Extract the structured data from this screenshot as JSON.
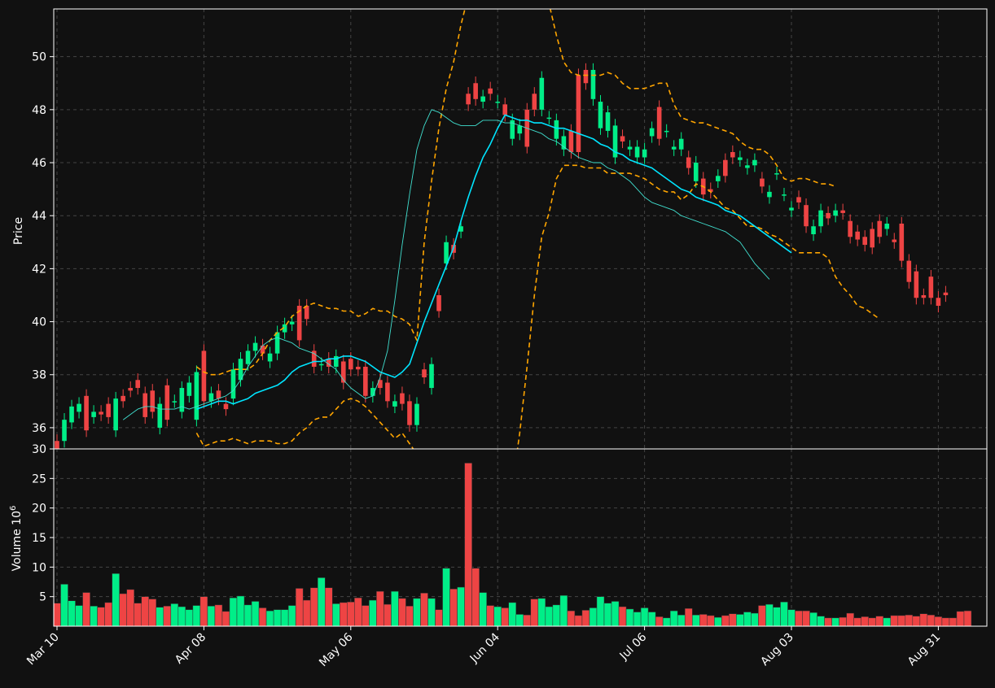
{
  "colors": {
    "background": "#111111",
    "up": "#00ee88",
    "down": "#ee4444",
    "bollinger": "#ffa500",
    "ma_slow": "#00e5ff",
    "ma_fast": "#40e0d0",
    "grid": "#444444",
    "axes": "#ffffff"
  },
  "chart_data": [
    {
      "type": "candlestick",
      "ylabel": "Price",
      "ylim": [
        35.2,
        51.8
      ],
      "yticks": [
        36,
        38,
        40,
        42,
        44,
        46,
        48,
        50
      ],
      "grid": true,
      "x_tick_labels": [
        "Mar 10",
        "Apr 08",
        "May 06",
        "Jun 04",
        "Jul 06",
        "Aug 03",
        "Aug 31"
      ],
      "x_tick_index": [
        0,
        20,
        40,
        60,
        80,
        100,
        120
      ],
      "open": [
        35.5,
        35.5,
        36.2,
        36.6,
        37.2,
        36.4,
        36.6,
        36.9,
        35.9,
        37.2,
        37.5,
        37.8,
        37.3,
        37.4,
        36.0,
        37.6,
        37.0,
        36.6,
        37.2,
        36.3,
        38.9,
        37.0,
        37.4,
        36.9,
        37.1,
        37.8,
        38.4,
        38.9,
        39.1,
        38.5,
        38.8,
        39.6,
        39.9,
        40.6,
        40.6,
        38.9,
        38.4,
        38.6,
        38.3,
        38.5,
        38.6,
        38.3,
        38.3,
        37.2,
        37.8,
        37.7,
        36.8,
        37.3,
        37.0,
        36.1,
        38.2,
        37.5,
        41.0,
        42.2,
        42.9,
        43.4,
        48.6,
        49.0,
        48.3,
        48.8,
        48.3,
        48.2,
        46.9,
        47.1,
        48.0,
        48.6,
        48.0,
        47.7,
        46.9,
        46.5,
        47.2,
        49.3,
        49.5,
        48.4,
        47.3,
        47.2,
        46.2,
        47.0,
        46.5,
        46.2,
        46.2,
        47.0,
        48.1,
        47.2,
        46.5,
        46.5,
        46.2,
        45.3,
        45.4,
        45.0,
        45.3,
        46.1,
        46.4,
        46.1,
        45.8,
        45.9,
        45.4,
        44.7,
        45.6,
        44.8,
        44.2,
        44.7,
        44.4,
        43.3,
        43.6,
        44.1,
        44.0,
        44.2,
        43.8,
        43.4,
        43.2,
        43.5,
        43.8,
        43.5,
        43.1,
        43.7,
        42.3,
        41.9,
        41.0,
        41.7,
        40.9,
        41.1
      ],
      "close": [
        35.2,
        36.3,
        36.8,
        36.9,
        35.9,
        36.6,
        36.5,
        36.4,
        37.1,
        37.0,
        37.4,
        37.5,
        36.4,
        36.6,
        36.9,
        36.3,
        37.0,
        37.5,
        37.7,
        38.1,
        37.0,
        37.3,
        37.1,
        36.7,
        38.2,
        38.6,
        38.9,
        39.2,
        38.8,
        38.8,
        39.6,
        39.9,
        40.0,
        39.3,
        40.1,
        38.3,
        38.4,
        38.3,
        38.7,
        37.7,
        38.2,
        38.2,
        37.2,
        37.5,
        37.5,
        37.0,
        37.0,
        36.9,
        36.1,
        36.9,
        37.9,
        38.4,
        40.4,
        43.0,
        42.6,
        43.6,
        48.2,
        48.4,
        48.5,
        48.6,
        48.3,
        47.8,
        47.6,
        47.4,
        46.6,
        48.0,
        49.2,
        47.7,
        47.6,
        47.0,
        46.4,
        46.4,
        49.0,
        49.5,
        48.3,
        47.9,
        47.4,
        46.8,
        46.6,
        46.6,
        46.5,
        47.3,
        46.9,
        47.2,
        46.6,
        46.9,
        45.8,
        46.0,
        44.8,
        44.9,
        45.5,
        45.5,
        46.2,
        46.2,
        45.9,
        46.1,
        45.1,
        44.9,
        45.6,
        44.8,
        44.3,
        44.5,
        43.6,
        43.6,
        44.2,
        43.9,
        44.2,
        44.1,
        43.2,
        43.1,
        42.9,
        42.8,
        43.2,
        43.7,
        43.0,
        42.3,
        41.5,
        40.9,
        40.9,
        40.9,
        40.6,
        41.0
      ]
    },
    {
      "type": "line",
      "series": [
        {
          "color": "#ffa500",
          "style": "dashed",
          "start_index": 19,
          "values": [
            38.3,
            38.1,
            38.0,
            38.0,
            38.1,
            38.2,
            38.2,
            38.2,
            38.4,
            38.8,
            39.3,
            39.6,
            39.8,
            40.2,
            40.4,
            40.6,
            40.7,
            40.6,
            40.5,
            40.5,
            40.4,
            40.4,
            40.2,
            40.3,
            40.5,
            40.4,
            40.4,
            40.2,
            40.1,
            39.9,
            39.3,
            43.0,
            45.3,
            47.3,
            48.8,
            49.8,
            51.2,
            52.3,
            53.4,
            53.4,
            53.4,
            53.4,
            53.4,
            53.4,
            53.4,
            53.4,
            53.4,
            53.2,
            52.0,
            50.8,
            49.8,
            49.4,
            49.3,
            49.3,
            49.3,
            49.3,
            49.4,
            49.3,
            49.0,
            48.8,
            48.8,
            48.8,
            48.9,
            49.0,
            49.0,
            48.2,
            47.7,
            47.6,
            47.5,
            47.5,
            47.4,
            47.3,
            47.2,
            47.1,
            46.8,
            46.6,
            46.5,
            46.5,
            46.3,
            45.9,
            45.4,
            45.3,
            45.4,
            45.4,
            45.3,
            45.2,
            45.2,
            45.1
          ]
        },
        {
          "color": "#ffa500",
          "style": "dashed",
          "start_index": 19,
          "values": [
            35.8,
            35.3,
            35.4,
            35.5,
            35.5,
            35.6,
            35.5,
            35.4,
            35.5,
            35.5,
            35.5,
            35.4,
            35.4,
            35.5,
            35.8,
            36.0,
            36.3,
            36.4,
            36.4,
            36.7,
            37.0,
            37.1,
            37.0,
            36.8,
            36.5,
            36.2,
            35.9,
            35.6,
            35.8,
            35.4,
            35.0,
            34.5,
            33.8,
            32.5,
            31.5,
            30.5,
            30.5,
            30.5,
            30.5,
            30.5,
            30.5,
            30.5,
            31.5,
            33.8,
            35.8,
            38.3,
            41.0,
            43.2,
            44.1,
            45.4,
            45.9,
            45.9,
            45.9,
            45.8,
            45.8,
            45.8,
            45.6,
            45.6,
            45.6,
            45.6,
            45.5,
            45.4,
            45.2,
            45.0,
            44.9,
            44.9,
            44.6,
            44.8,
            45.2,
            45.1,
            44.9,
            44.6,
            44.3,
            44.2,
            43.9,
            43.6,
            43.6,
            43.5,
            43.3,
            43.2,
            43.0,
            42.8,
            42.6,
            42.6,
            42.6,
            42.6,
            42.4,
            41.7,
            41.3,
            41.0,
            40.6,
            40.5,
            40.3,
            40.1
          ]
        },
        {
          "color": "#00e5ff",
          "style": "solid",
          "width": 1.6,
          "start_index": 19,
          "values": [
            36.7,
            36.8,
            36.9,
            37.0,
            37.0,
            36.9,
            37.0,
            37.1,
            37.3,
            37.4,
            37.5,
            37.6,
            37.8,
            38.1,
            38.3,
            38.4,
            38.5,
            38.5,
            38.6,
            38.6,
            38.7,
            38.7,
            38.6,
            38.5,
            38.3,
            38.1,
            38.0,
            37.9,
            38.1,
            38.4,
            39.2,
            40.0,
            40.7,
            41.4,
            42.1,
            42.8,
            43.8,
            44.7,
            45.5,
            46.2,
            46.7,
            47.3,
            47.8,
            47.7,
            47.6,
            47.6,
            47.5,
            47.5,
            47.4,
            47.3,
            47.3,
            47.2,
            47.1,
            47.0,
            46.9,
            46.7,
            46.6,
            46.4,
            46.3,
            46.1,
            46.0,
            45.9,
            45.8,
            45.6,
            45.4,
            45.2,
            45.0,
            44.9,
            44.7,
            44.6,
            44.5,
            44.4,
            44.2,
            44.1,
            44.0,
            43.8,
            43.6,
            43.4,
            43.2,
            43.0,
            42.8,
            42.6
          ]
        },
        {
          "color": "#40e0d0",
          "style": "solid",
          "width": 0.9,
          "start_index": 9,
          "values": [
            36.3,
            36.5,
            36.7,
            36.8,
            36.8,
            36.7,
            36.7,
            36.7,
            36.8,
            36.7,
            36.8,
            36.9,
            37.0,
            37.1,
            37.2,
            37.4,
            37.8,
            38.3,
            38.7,
            39.1,
            39.3,
            39.4,
            39.3,
            39.2,
            39.0,
            38.9,
            38.8,
            38.6,
            38.4,
            38.2,
            37.8,
            37.5,
            37.3,
            37.1,
            37.2,
            37.9,
            38.9,
            40.8,
            42.9,
            44.8,
            46.5,
            47.4,
            48.0,
            47.9,
            47.7,
            47.5,
            47.4,
            47.4,
            47.4,
            47.6,
            47.6,
            47.6,
            47.5,
            47.5,
            47.4,
            47.3,
            47.2,
            47.1,
            46.9,
            46.8,
            46.6,
            46.4,
            46.2,
            46.1,
            46.0,
            46.0,
            45.8,
            45.7,
            45.5,
            45.3,
            45.0,
            44.7,
            44.5,
            44.4,
            44.3,
            44.2,
            44.0,
            43.9,
            43.8,
            43.7,
            43.6,
            43.5,
            43.4,
            43.2,
            43.0,
            42.6,
            42.2,
            41.9,
            41.6
          ]
        }
      ]
    },
    {
      "type": "bar",
      "ylabel": "Volume  10",
      "ylabel_exponent": "6",
      "ylim": [
        0,
        30
      ],
      "yticks": [
        5,
        10,
        15,
        20,
        25,
        30
      ],
      "grid": true,
      "values": [
        3.9,
        7.1,
        4.3,
        3.5,
        5.7,
        3.4,
        3.2,
        4.0,
        8.9,
        5.5,
        6.2,
        3.9,
        5.0,
        4.6,
        3.2,
        3.4,
        3.8,
        3.3,
        2.8,
        3.5,
        5.0,
        3.4,
        3.6,
        2.5,
        4.8,
        5.1,
        3.6,
        4.2,
        3.1,
        2.6,
        2.8,
        2.8,
        3.5,
        6.4,
        4.4,
        6.5,
        8.2,
        6.5,
        3.8,
        4.0,
        4.1,
        4.8,
        3.5,
        4.4,
        5.9,
        3.7,
        5.9,
        4.7,
        3.4,
        4.7,
        5.6,
        4.7,
        2.8,
        9.8,
        6.3,
        6.6,
        27.6,
        9.8,
        5.7,
        3.5,
        3.3,
        3.1,
        4.0,
        2.0,
        1.9,
        4.6,
        4.7,
        3.3,
        3.6,
        5.2,
        2.6,
        1.8,
        2.7,
        3.1,
        5.0,
        3.9,
        4.2,
        3.3,
        2.9,
        2.4,
        3.1,
        2.4,
        1.6,
        1.4,
        2.6,
        1.9,
        3.0,
        1.9,
        2.0,
        1.8,
        1.5,
        1.8,
        2.1,
        2.0,
        2.4,
        2.2,
        3.5,
        3.7,
        3.2,
        4.1,
        2.8,
        2.6,
        2.6,
        2.3,
        1.7,
        1.4,
        1.4,
        1.5,
        2.2,
        1.4,
        1.6,
        1.4,
        1.7,
        1.4,
        1.8,
        1.8,
        1.9,
        1.7,
        2.1,
        1.9,
        1.6,
        1.4,
        1.4,
        2.5,
        2.6
      ]
    }
  ]
}
